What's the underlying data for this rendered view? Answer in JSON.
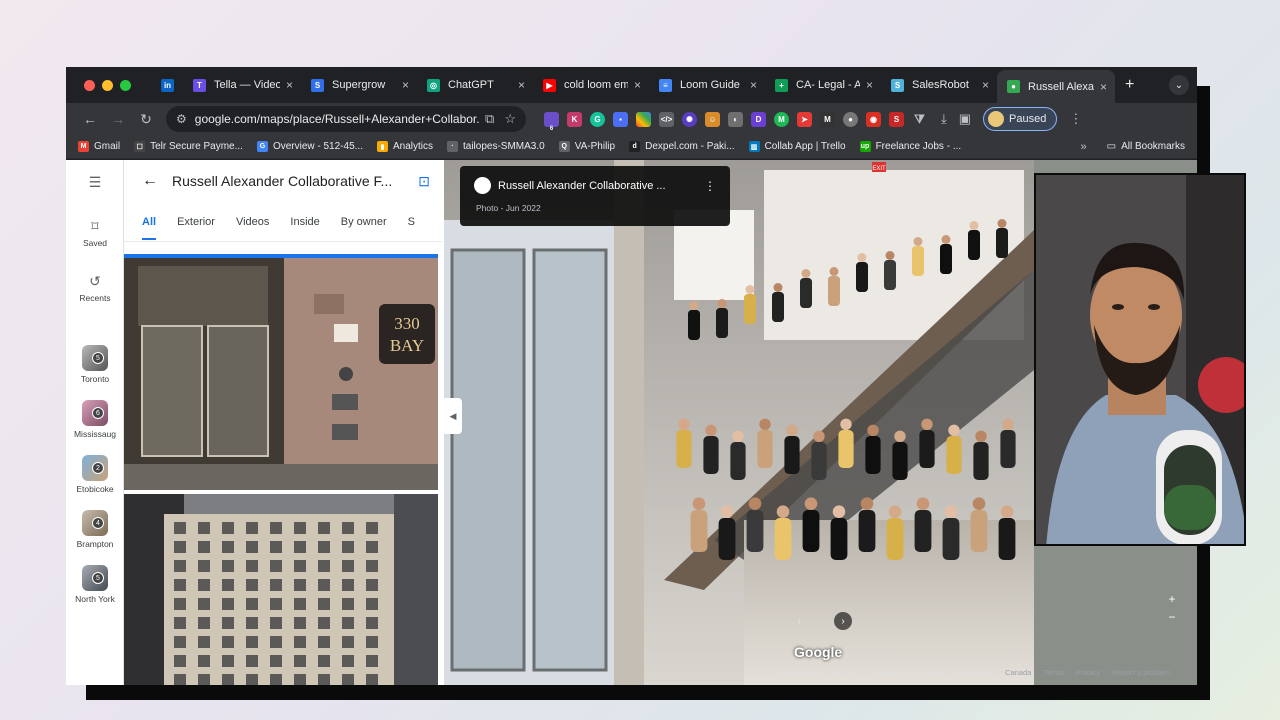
{
  "tabs": [
    {
      "title": "",
      "icon": "linkedin-icon",
      "color": "#0a66c2",
      "glyph": "in"
    },
    {
      "title": "Tella — Video",
      "icon": "tella-icon",
      "color": "#6b4ee6",
      "glyph": "T"
    },
    {
      "title": "Supergrow",
      "icon": "supergrow-icon",
      "color": "#2f6fe8",
      "glyph": "S"
    },
    {
      "title": "ChatGPT",
      "icon": "chatgpt-icon",
      "color": "#10a37f",
      "glyph": "◎"
    },
    {
      "title": "cold loom em",
      "icon": "youtube-icon",
      "color": "#ff0000",
      "glyph": "▶"
    },
    {
      "title": "Loom Guide",
      "icon": "docs-icon",
      "color": "#4285f4",
      "glyph": "≡"
    },
    {
      "title": "CA- Legal - A",
      "icon": "sheets-icon",
      "color": "#0f9d58",
      "glyph": "+"
    },
    {
      "title": "SalesRobot",
      "icon": "salesrobot-icon",
      "color": "#4fb3d9",
      "glyph": "S"
    },
    {
      "title": "Russell Alexa",
      "icon": "maps-icon",
      "color": "#34a853",
      "glyph": "●"
    }
  ],
  "url": "google.com/maps/place/Russell+Alexander+Collabor...",
  "profile": {
    "status": "Paused"
  },
  "extension_badge": "6",
  "bookmarks": [
    {
      "label": "Gmail",
      "icon": "gmail-icon",
      "color": "#ea4335",
      "glyph": "M"
    },
    {
      "label": "Telr Secure Payme...",
      "icon": "telr-icon",
      "color": "#444444",
      "glyph": "☐"
    },
    {
      "label": "Overview - 512-45...",
      "icon": "google-icon",
      "color": "#4285f4",
      "glyph": "G"
    },
    {
      "label": "Analytics",
      "icon": "analytics-icon",
      "color": "#f9ab00",
      "glyph": "▮"
    },
    {
      "label": "tailopes-SMMA3.0",
      "icon": "tailopes-icon",
      "color": "#5f6368",
      "glyph": "·"
    },
    {
      "label": "VA-Philip",
      "icon": "va-icon",
      "color": "#5f6368",
      "glyph": "Q"
    },
    {
      "label": "Dexpel.com - Paki...",
      "icon": "dexpel-icon",
      "color": "#202124",
      "glyph": "d"
    },
    {
      "label": "Collab App | Trello",
      "icon": "trello-icon",
      "color": "#0079bf",
      "glyph": "▥"
    },
    {
      "label": "Freelance Jobs - ...",
      "icon": "upwork-icon",
      "color": "#14a800",
      "glyph": "up"
    }
  ],
  "bookmarks_all": "All Bookmarks",
  "rail": {
    "saved": "Saved",
    "recents": "Recents",
    "places": [
      {
        "label": "Toronto",
        "badge": "5"
      },
      {
        "label": "Mississaug",
        "badge": "6"
      },
      {
        "label": "Etobicoke",
        "badge": "2"
      },
      {
        "label": "Brampton",
        "badge": "4"
      },
      {
        "label": "North York",
        "badge": "5"
      }
    ]
  },
  "panel": {
    "title": "Russell Alexander Collaborative F...",
    "tabs": [
      "All",
      "Exterior",
      "Videos",
      "Inside",
      "By owner",
      "S"
    ],
    "sign": [
      "330",
      "BAY"
    ]
  },
  "viewer": {
    "card_title": "Russell Alexander Collaborative ...",
    "card_sub": "Photo - Jun 2022",
    "exit_sign": "EXIT",
    "watermark": "Google",
    "footer": [
      "Image capture: Jun 2022",
      "Images may be subject to copyright.",
      "Canada",
      "Terms",
      "Privacy",
      "Report a problem"
    ]
  }
}
